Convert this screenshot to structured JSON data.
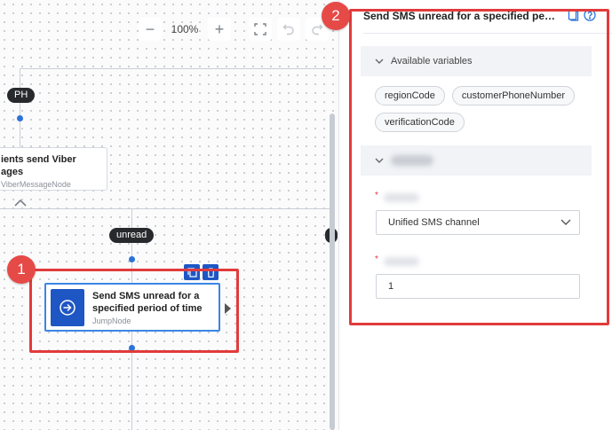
{
  "toolbar": {
    "zoom_out_label": "−",
    "zoom_level": "100%",
    "zoom_in_label": "+",
    "fit_icon": "fit-screen-icon",
    "undo_icon": "undo-icon",
    "redo_icon": "redo-icon"
  },
  "canvas": {
    "top_label": "PH",
    "branch_label": "unread",
    "viber_node": {
      "title_line1": "ients send Viber",
      "title_line2": "ages",
      "type": "ViberMessageNode"
    },
    "jump_node": {
      "title_line1": "Send SMS unread for a",
      "title_line2": "specified period of time",
      "type": "JumpNode",
      "copy_icon": "copy-icon",
      "delete_icon": "delete-icon"
    }
  },
  "panel": {
    "title": "Send SMS unread for a specified period of time",
    "doc_icon": "document-icon",
    "help_icon": "help-icon",
    "variables_section_label": "Available variables",
    "variables": [
      "regionCode",
      "customerPhoneNumber",
      "verificationCode"
    ],
    "required_marker": "*",
    "channel_value": "Unified SMS channel",
    "count_value": "1"
  },
  "annotations": {
    "badge1": "1",
    "badge2": "2",
    "highlight_color": "#e23b3b"
  },
  "colors": {
    "accent_blue": "#1e56c4",
    "link_blue": "#3a86e6"
  }
}
